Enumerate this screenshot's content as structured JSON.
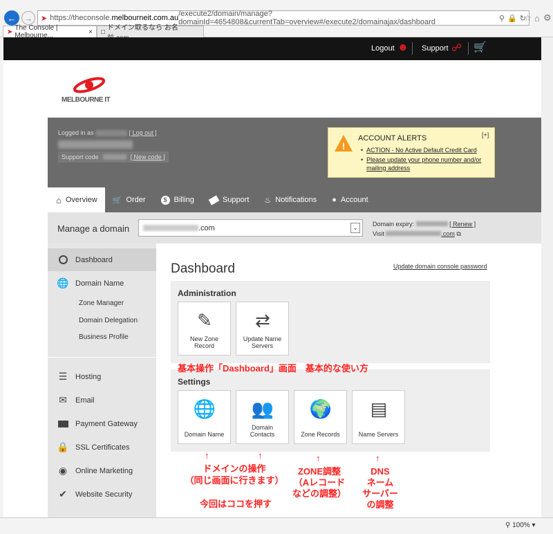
{
  "browser": {
    "url_prefix": "https://theconsole.",
    "url_domain": "melbourneit.com.au",
    "url_rest": "/execute2/domain/manage?domainId=4654808&currentTab=overview#/execute2/domainajax/dashboard",
    "tabs": [
      "The Console | Melbourne...",
      "ドメイン取るなら お名前.com"
    ],
    "zoom": "100%"
  },
  "topbar": {
    "logout": "Logout",
    "support": "Support"
  },
  "brand": {
    "logo_text": "MELBOURNE IT"
  },
  "user": {
    "logged_in_as": "Logged in as",
    "logout_link": "[ Log out ]",
    "support_code_label": "Support code",
    "new_code_link": "[ New code ]"
  },
  "alerts": {
    "title": "ACCOUNT ALERTS",
    "expand": "[+]",
    "items": [
      "ACTION - No Active Default Credit Card",
      "Please update your phone number and/or mailing address"
    ]
  },
  "nav": {
    "items": [
      "Overview",
      "Order",
      "Billing",
      "Support",
      "Notifications",
      "Account"
    ]
  },
  "domain_bar": {
    "label": "Manage a domain",
    "selected_suffix": ".com",
    "expiry_label": "Domain expiry:",
    "renew": "[ Renew ]",
    "visit_label": "Visit",
    "visit_suffix": ".com"
  },
  "sidebar": {
    "items": [
      "Dashboard",
      "Domain Name",
      "Hosting",
      "Email",
      "Payment Gateway",
      "SSL Certificates",
      "Online Marketing",
      "Website Security"
    ],
    "sub_items": [
      "Zone Manager",
      "Domain Delegation",
      "Business Profile"
    ]
  },
  "main": {
    "title": "Dashboard",
    "password_link": "Update domain console password",
    "admin_heading": "Administration",
    "admin_tiles": [
      "New Zone\nRecord",
      "Update Name\nServers"
    ],
    "settings_heading": "Settings",
    "settings_tiles": [
      "Domain Name",
      "Domain\nContacts",
      "Zone Records",
      "Name Servers"
    ]
  },
  "annotations": {
    "banner": "基本操作「Dashboard」画面　基本的な使い方",
    "arrow": "↑",
    "domain_op": "ドメインの操作\n（同じ画面に行きます）",
    "press_here": "今回はココを押す",
    "zone": "ZONE調整\n（Aレコード\nなどの調整）",
    "dns": "DNS\nネーム\nサーバー\nの調整"
  },
  "colors": {
    "brand_red": "#e31b23",
    "alert_bg": "#fdf6c3",
    "annotation": "#ff2222"
  }
}
